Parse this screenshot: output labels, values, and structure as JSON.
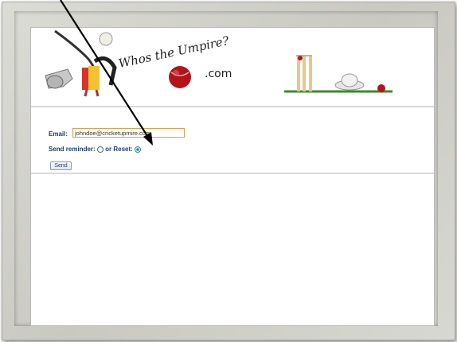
{
  "site": {
    "logo_title": "Whos the Umpire?",
    "logo_suffix": ".com"
  },
  "form": {
    "email_label": "Email:",
    "email_value": "johndoe@cricketupmire.com",
    "send_reminder_label": "Send reminder:",
    "reset_label": "or Reset:",
    "reset_selected": true,
    "send_button_label": "Send"
  },
  "colors": {
    "label_blue": "#1e3a7a",
    "input_border": "#d9a14a",
    "frame_gray": "#cfcfc9",
    "arrow": "#000000"
  },
  "icons": [
    "whistle-icon",
    "cricket-ball-icon",
    "wicket-stumps-icon",
    "umpire-hat-icon",
    "arrow-annotation"
  ]
}
